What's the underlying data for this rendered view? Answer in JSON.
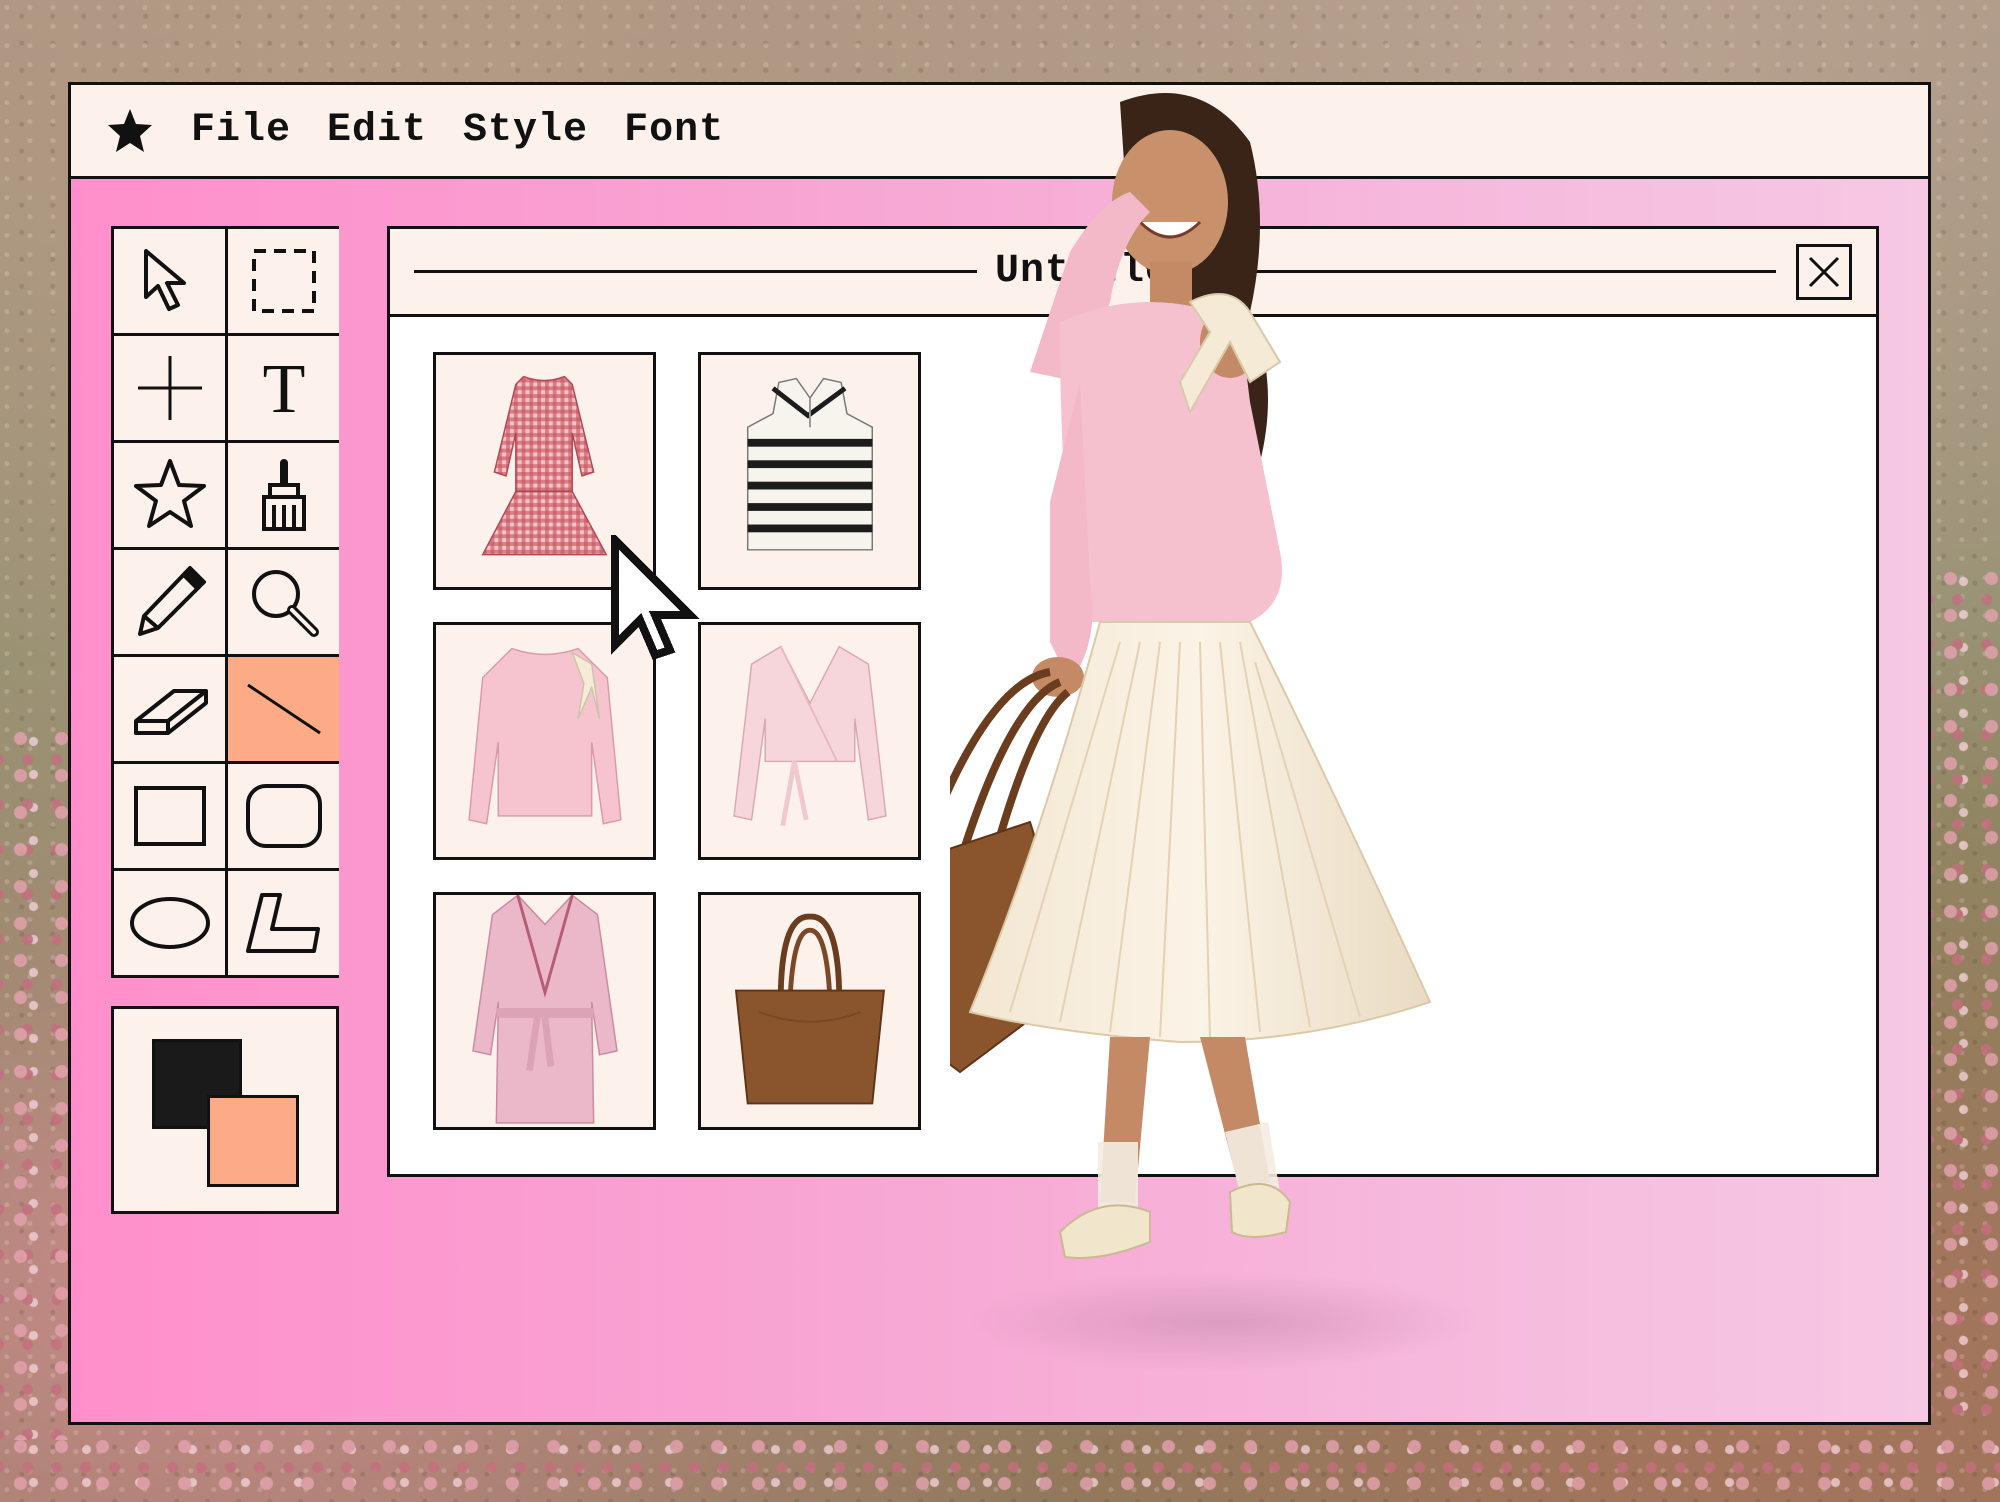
{
  "menubar": {
    "logo_icon": "star-icon",
    "items": [
      {
        "label": "File"
      },
      {
        "label": "Edit"
      },
      {
        "label": "Style"
      },
      {
        "label": "Font"
      }
    ]
  },
  "tools": [
    {
      "name": "arrow-select",
      "icon": "arrow-pointer-icon"
    },
    {
      "name": "marquee-select",
      "icon": "dashed-rectangle-icon"
    },
    {
      "name": "crosshair",
      "icon": "crosshair-icon"
    },
    {
      "name": "text",
      "icon": "text-t-icon",
      "glyph": "T"
    },
    {
      "name": "star-shape",
      "icon": "star-outline-icon"
    },
    {
      "name": "paint-brush",
      "icon": "brush-icon"
    },
    {
      "name": "pencil",
      "icon": "pencil-icon"
    },
    {
      "name": "zoom",
      "icon": "magnifier-icon"
    },
    {
      "name": "eraser",
      "icon": "eraser-icon"
    },
    {
      "name": "line",
      "icon": "line-icon",
      "active": true
    },
    {
      "name": "rectangle",
      "icon": "rectangle-icon"
    },
    {
      "name": "rounded-rectangle",
      "icon": "rounded-rectangle-icon"
    },
    {
      "name": "ellipse",
      "icon": "ellipse-icon"
    },
    {
      "name": "polygon",
      "icon": "polygon-icon"
    }
  ],
  "colors": {
    "foreground": "#1a1a1a",
    "background": "#fcab86",
    "accent_pink": "#ff8fcc",
    "window_bg": "#fdf1ec"
  },
  "document": {
    "title": "Untitled",
    "close_icon": "close-x-icon"
  },
  "products": [
    {
      "name": "red-gingham-dress",
      "icon": "dress-icon"
    },
    {
      "name": "striped-sweater-vest",
      "icon": "vest-icon"
    },
    {
      "name": "pink-bow-sweater",
      "icon": "sweater-icon"
    },
    {
      "name": "pink-wrap-top",
      "icon": "wrap-top-icon"
    },
    {
      "name": "pink-robe",
      "icon": "robe-icon"
    },
    {
      "name": "brown-suede-tote",
      "icon": "tote-bag-icon"
    }
  ]
}
